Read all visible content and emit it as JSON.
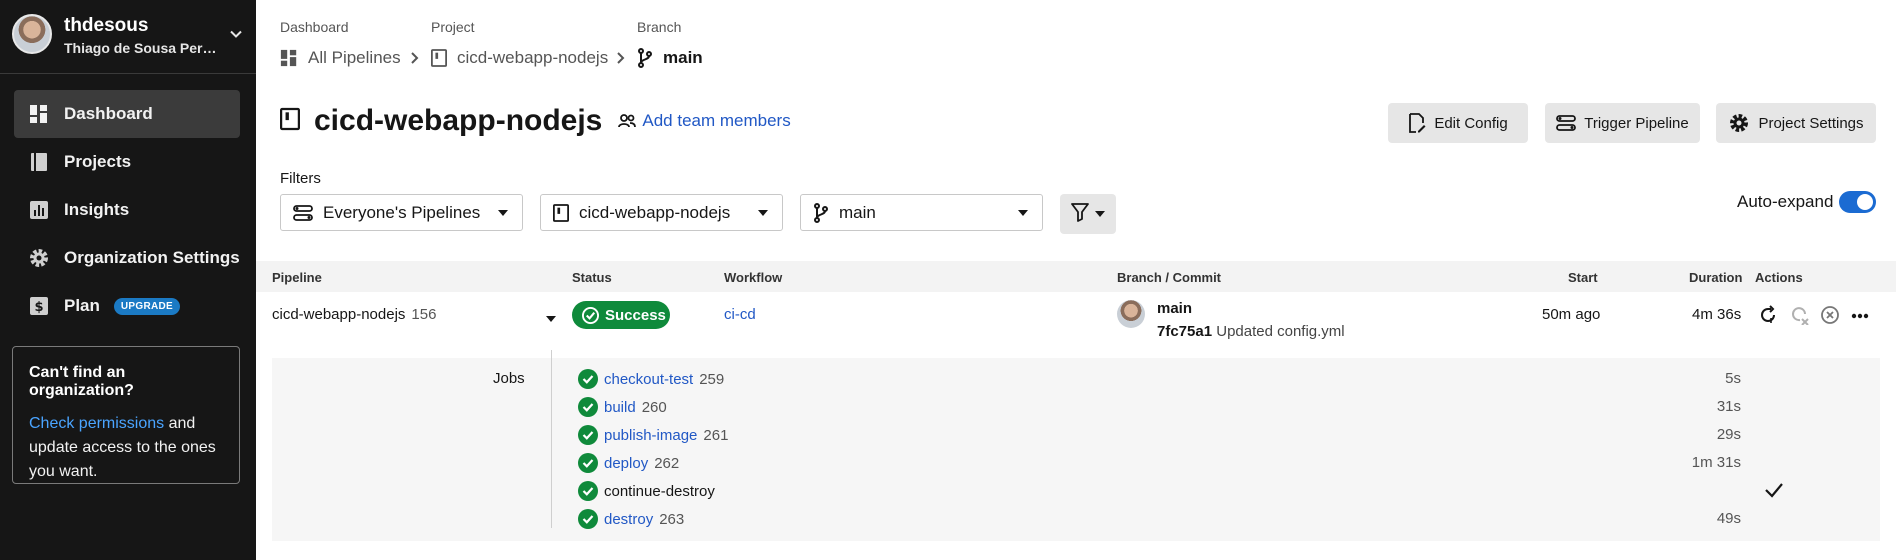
{
  "user": {
    "handle": "thdesous",
    "name": "Thiago de Sousa Per…"
  },
  "nav": [
    {
      "label": "Dashboard",
      "icon": "dashboard-icon",
      "active": true
    },
    {
      "label": "Projects",
      "icon": "projects-icon"
    },
    {
      "label": "Insights",
      "icon": "insights-icon"
    },
    {
      "label": "Organization Settings",
      "icon": "gear-icon"
    },
    {
      "label": "Plan",
      "icon": "dollar-icon",
      "badge": "UPGRADE"
    }
  ],
  "org_box": {
    "title": "Can't find an organization?",
    "link": "Check permissions",
    "text": " and update access to the ones you want."
  },
  "breadcrumb": {
    "labels": [
      "Dashboard",
      "Project",
      "Branch"
    ],
    "items": [
      "All Pipelines",
      "cicd-webapp-nodejs",
      "main"
    ]
  },
  "header": {
    "title": "cicd-webapp-nodejs",
    "team_link": "Add team members",
    "buttons": [
      "Edit Config",
      "Trigger Pipeline",
      "Project Settings"
    ]
  },
  "filters": {
    "label": "Filters",
    "pipelines": "Everyone's Pipelines",
    "project": "cicd-webapp-nodejs",
    "branch": "main",
    "auto_expand_label": "Auto-expand",
    "auto_expand_on": true
  },
  "table": {
    "headers": [
      "Pipeline",
      "Status",
      "Workflow",
      "Branch / Commit",
      "Start",
      "Duration",
      "Actions"
    ],
    "row": {
      "pipeline": "cicd-webapp-nodejs",
      "number": "156",
      "status": "Success",
      "workflow": "ci-cd",
      "branch": "main",
      "commit_hash": "7fc75a1",
      "commit_msg": "Updated config.yml",
      "start": "50m ago",
      "duration": "4m 36s"
    },
    "jobs_label": "Jobs",
    "jobs": [
      {
        "name": "checkout-test",
        "number": "259",
        "duration": "5s"
      },
      {
        "name": "build",
        "number": "260",
        "duration": "31s"
      },
      {
        "name": "publish-image",
        "number": "261",
        "duration": "29s"
      },
      {
        "name": "deploy",
        "number": "262",
        "duration": "1m 31s"
      },
      {
        "name": "continue-destroy",
        "number": "",
        "duration": ""
      },
      {
        "name": "destroy",
        "number": "263",
        "duration": "49s"
      }
    ]
  },
  "colors": {
    "sidebar_bg": "#161616",
    "accent": "#2158c5",
    "success": "#0f8a3b",
    "badge": "#1b7ac4"
  }
}
